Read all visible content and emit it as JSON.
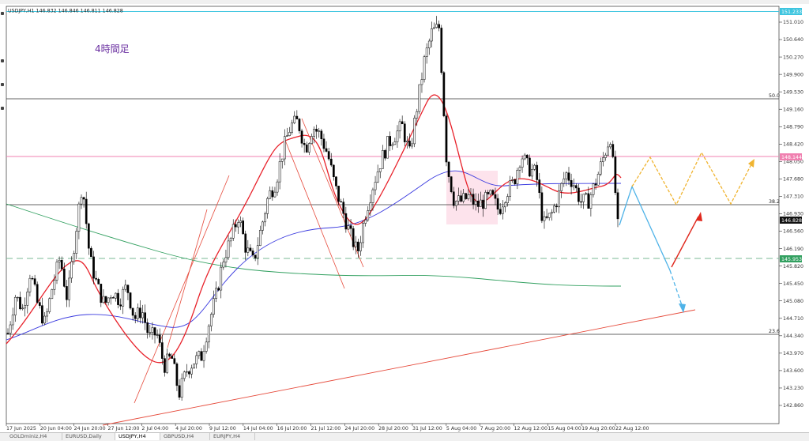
{
  "header": {
    "symbol_line": "USDJPY,H1  146.832 146.846 146.811 146.828"
  },
  "annotation": {
    "timeframe_note": "4時間足"
  },
  "price_axis": {
    "ticks": [
      "151.010",
      "150.640",
      "150.270",
      "149.900",
      "149.530",
      "149.160",
      "148.790",
      "148.420",
      "148.050",
      "147.680",
      "147.310",
      "146.930",
      "146.560",
      "146.190",
      "145.820",
      "145.450",
      "145.080",
      "144.710",
      "144.340",
      "143.970",
      "143.600",
      "143.230",
      "142.860"
    ],
    "tag_top": "151.233",
    "tag_pink": "148.144",
    "tag_price": "146.828",
    "tag_green": "145.953"
  },
  "fib_labels": {
    "f50": "50.0",
    "f382": "38.2",
    "f236": "23.6"
  },
  "time_axis": [
    "17 Jun 2025",
    "20 Jun 04:00",
    "24 Jun 20:00",
    "27 Jun 12:00",
    "2 Jul 04:00",
    "4 Jul 20:00",
    "9 Jul 12:00",
    "14 Jul 04:00",
    "16 Jul 20:00",
    "21 Jul 12:00",
    "24 Jul 20:00",
    "28 Jul 20:00",
    "31 Jul 12:00",
    "5 Aug 04:00",
    "7 Aug 20:00",
    "12 Aug 12:00",
    "15 Aug 04:00",
    "19 Aug 20:00",
    "22 Aug 12:00"
  ],
  "tabs": [
    "GOLDminiz,H4",
    "EURUSD,Daily",
    "USDJPY,H4",
    "GBPUSD,H4",
    "EURJPY,H4"
  ],
  "active_tab": 2,
  "chart_data": {
    "type": "candlestick",
    "symbol": "USDJPY",
    "timeframe": "H1",
    "ylim": [
      142.68,
      151.38
    ],
    "close_path": [
      144.4,
      145.2,
      144.9,
      145.7,
      145.0,
      144.6,
      145.4,
      146.0,
      145.1,
      146.4,
      147.6,
      146.0,
      145.4,
      145.0,
      145.3,
      145.1,
      145.4,
      144.7,
      144.9,
      144.3,
      144.4,
      143.7,
      143.9,
      143.1,
      143.6,
      143.8,
      143.9,
      144.6,
      145.2,
      146.0,
      146.4,
      146.9,
      146.2,
      145.9,
      146.6,
      147.3,
      147.6,
      148.3,
      148.8,
      148.9,
      148.3,
      148.8,
      148.6,
      148.2,
      147.5,
      147.0,
      146.5,
      146.1,
      146.9,
      147.5,
      148.0,
      148.4,
      148.6,
      148.8,
      148.2,
      149.2,
      150.2,
      150.8,
      150.9,
      148.0,
      147.2,
      147.2,
      147.3,
      147.1,
      147.2,
      147.3,
      147.0,
      147.4,
      147.6,
      148.2,
      147.9,
      147.8,
      146.7,
      146.9,
      147.3,
      147.8,
      147.6,
      147.2,
      147.2,
      147.6,
      148.1,
      148.6,
      146.8
    ],
    "last_price": 146.828,
    "price_lines": {
      "top_cyan": 151.233,
      "pink_level": 148.144,
      "green_dashed": 145.953
    },
    "fib_levels": [
      {
        "label": "50.0",
        "price": 149.4
      },
      {
        "label": "38.2",
        "price": 147.0
      },
      {
        "label": "23.6",
        "price": 144.5
      }
    ],
    "moving_averages": [
      {
        "color": "#e8212a",
        "type": "fast"
      },
      {
        "color": "#3a3adf",
        "type": "medium"
      },
      {
        "color": "#32a060",
        "type": "slow"
      }
    ],
    "projections": [
      {
        "color": "#4fb3e8",
        "style": "solid-arrow",
        "direction": "up-then-down"
      },
      {
        "color": "#e0281d",
        "style": "solid-arrow",
        "direction": "up"
      },
      {
        "color": "#f0b430",
        "style": "dashed-zigzag",
        "direction": "range"
      }
    ],
    "highlight_zone": {
      "color": "#fde3ec",
      "from_price": 147.5,
      "to_price": 146.5
    }
  }
}
